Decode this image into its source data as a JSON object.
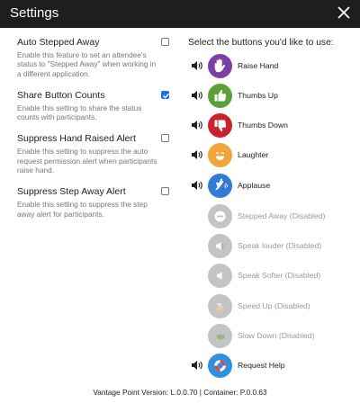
{
  "window": {
    "title": "Settings"
  },
  "settings": [
    {
      "title": "Auto Stepped Away",
      "description": "Enable this feature to set an attendee's status to \"Stepped Away\" when working in a different application.",
      "checked": false
    },
    {
      "title": "Share Button Counts",
      "description": "Enable this setting to share the status counts with participants.",
      "checked": true
    },
    {
      "title": "Suppress Hand Raised Alert",
      "description": "Enable this setting to suppress the auto request permission alert when participants raise hand.",
      "checked": false
    },
    {
      "title": "Suppress Step Away Alert",
      "description": "Enable this setting to suppress the step away alert for participants.",
      "checked": false
    }
  ],
  "buttons_panel": {
    "header": "Select the buttons you'd like to use:",
    "buttons": [
      {
        "label": "Raise Hand",
        "enabled": true,
        "icon": "raise-hand-icon",
        "color": "#7b3fa7"
      },
      {
        "label": "Thumbs Up",
        "enabled": true,
        "icon": "thumbs-up-icon",
        "color": "#5aa13a"
      },
      {
        "label": "Thumbs Down",
        "enabled": true,
        "icon": "thumbs-down-icon",
        "color": "#c8232c"
      },
      {
        "label": "Laughter",
        "enabled": true,
        "icon": "laughter-icon",
        "color": "#f2a43a"
      },
      {
        "label": "Applause",
        "enabled": true,
        "icon": "applause-icon",
        "color": "#2f7bd6"
      },
      {
        "label": "Stepped Away (Disabled)",
        "enabled": false,
        "icon": "stepped-away-icon",
        "color": "#c4c4c4"
      },
      {
        "label": "Speak louder (Disabled)",
        "enabled": false,
        "icon": "speak-louder-icon",
        "color": "#c4c4c4"
      },
      {
        "label": "Speak Softer (Disabled)",
        "enabled": false,
        "icon": "speak-softer-icon",
        "color": "#c4c4c4"
      },
      {
        "label": "Speed Up (Disabled)",
        "enabled": false,
        "icon": "speed-up-icon",
        "color": "#c4c4c4"
      },
      {
        "label": "Slow Down (Disabled)",
        "enabled": false,
        "icon": "slow-down-icon",
        "color": "#c4c4c4"
      },
      {
        "label": "Request Help",
        "enabled": true,
        "icon": "request-help-icon",
        "color": "#2f8fe0"
      }
    ]
  },
  "footer": {
    "version_text": "Vantage Point Version: L.0.0.70 | Container: P.0.0.63"
  }
}
